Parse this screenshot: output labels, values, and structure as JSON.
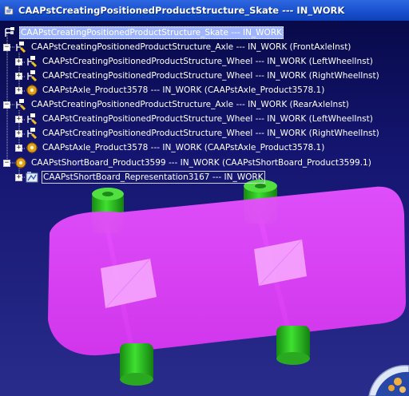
{
  "window": {
    "title": "CAAPstCreatingPositionedProductStructure_Skate --- IN_WORK"
  },
  "tree": {
    "nodes": [
      {
        "label": "CAAPstCreatingPositionedProductStructure_Skate --- IN_WORK",
        "icon": "product-root-icon"
      },
      {
        "label": "CAAPstCreatingPositionedProductStructure_Axle --- IN_WORK (FrontAxleInst)",
        "icon": "product-icon"
      },
      {
        "label": "CAAPstCreatingPositionedProductStructure_Wheel --- IN_WORK (LeftWheelInst)",
        "icon": "product-icon"
      },
      {
        "label": "CAAPstCreatingPositionedProductStructure_Wheel --- IN_WORK (RightWheelInst)",
        "icon": "product-icon"
      },
      {
        "label": "CAAPstAxle_Product3578 --- IN_WORK (CAAPstAxle_Product3578.1)",
        "icon": "gear-icon"
      },
      {
        "label": "CAAPstCreatingPositionedProductStructure_Axle --- IN_WORK (RearAxleInst)",
        "icon": "product-icon"
      },
      {
        "label": "CAAPstCreatingPositionedProductStructure_Wheel --- IN_WORK (LeftWheelInst)",
        "icon": "product-icon"
      },
      {
        "label": "CAAPstCreatingPositionedProductStructure_Wheel --- IN_WORK (RightWheelInst)",
        "icon": "product-icon"
      },
      {
        "label": "CAAPstAxle_Product3578 --- IN_WORK (CAAPstAxle_Product3578.1)",
        "icon": "gear-icon"
      },
      {
        "label": "CAAPstShortBoard_Product3599 --- IN_WORK (CAAPstShortBoard_Product3599.1)",
        "icon": "gear-icon"
      },
      {
        "label": "CAAPstShortBoard_Representation3167 --- IN_WORK",
        "icon": "representation-icon"
      }
    ]
  },
  "colors": {
    "background_top": "#080a4a",
    "background_bottom": "#2a2c8c",
    "board": "#e040ff",
    "wheel": "#22c01a",
    "selection": "#9fb5ff"
  }
}
